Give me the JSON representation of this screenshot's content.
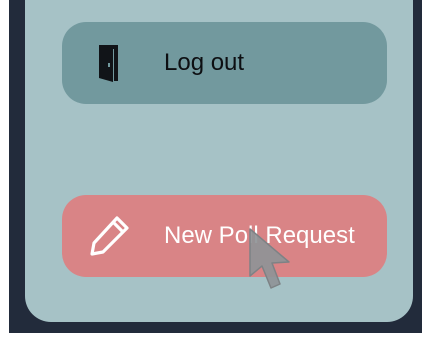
{
  "menu": {
    "logout": {
      "label": "Log out",
      "icon": "door-exit-icon"
    },
    "new_poll": {
      "label": "New Poll Request",
      "icon": "pencil-icon"
    }
  },
  "colors": {
    "panel": "#a6c2c6",
    "background": "#222b3b",
    "logout_button": "#72999e",
    "new_poll_button": "#d98486",
    "cursor": "#8f9497"
  }
}
